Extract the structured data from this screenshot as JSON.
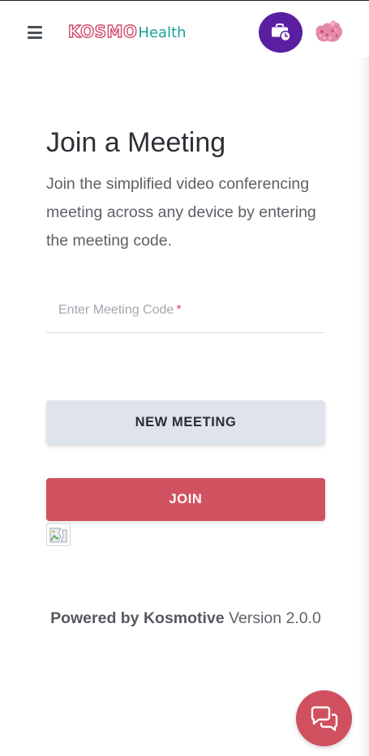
{
  "header": {
    "logo_kosmo": "KOSMO",
    "logo_health": "Health",
    "menu_icon": "hamburger-menu-icon",
    "briefcase_icon": "briefcase-clock-icon",
    "avatar_icon": "user-avatar-icon"
  },
  "main": {
    "title": "Join a Meeting",
    "subtitle": "Join the simplified video conferencing meeting across any device by entering the meeting code.",
    "meeting_code": {
      "placeholder": "Enter Meeting Code",
      "required_mark": "*",
      "value": ""
    },
    "new_meeting_label": "NEW MEETING",
    "join_label": "JOIN",
    "broken_image_icon": "broken-image-icon"
  },
  "footer": {
    "powered_by": "Powered by Kosmotive",
    "version": "Version 2.0.0"
  },
  "chat": {
    "icon": "chat-bubbles-icon"
  },
  "colors": {
    "brand_pink": "#d0486b",
    "brand_teal": "#18a29a",
    "purple": "#5a1fa0",
    "join_red": "#d05160",
    "new_meeting_gray": "#dfe3ea"
  }
}
